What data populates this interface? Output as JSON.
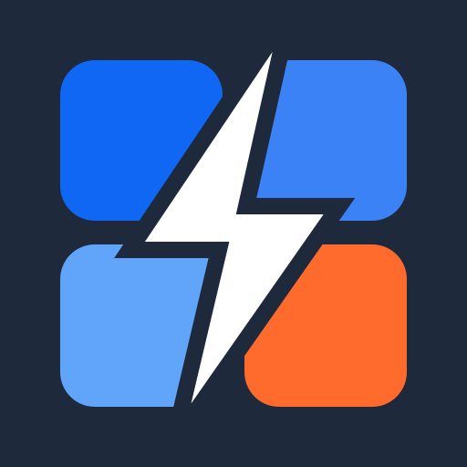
{
  "app_icon": {
    "name": "lightning-grid-icon",
    "colors": {
      "background": "#1E293B",
      "tile_top_left": "#0F67F4",
      "tile_top_right": "#3B82F6",
      "tile_bottom_left": "#60A5FA",
      "tile_bottom_right": "#FF6B2C",
      "bolt_fill": "#FFFFFF",
      "bolt_outline": "#1E293B"
    },
    "tiles": [
      {
        "name": "tile-top-left",
        "icon": "rounded-square-icon"
      },
      {
        "name": "tile-top-right",
        "icon": "rounded-square-icon"
      },
      {
        "name": "tile-bottom-left",
        "icon": "rounded-square-icon"
      },
      {
        "name": "tile-bottom-right",
        "icon": "rounded-square-icon"
      }
    ],
    "bolt": {
      "icon": "lightning-bolt-icon"
    }
  }
}
